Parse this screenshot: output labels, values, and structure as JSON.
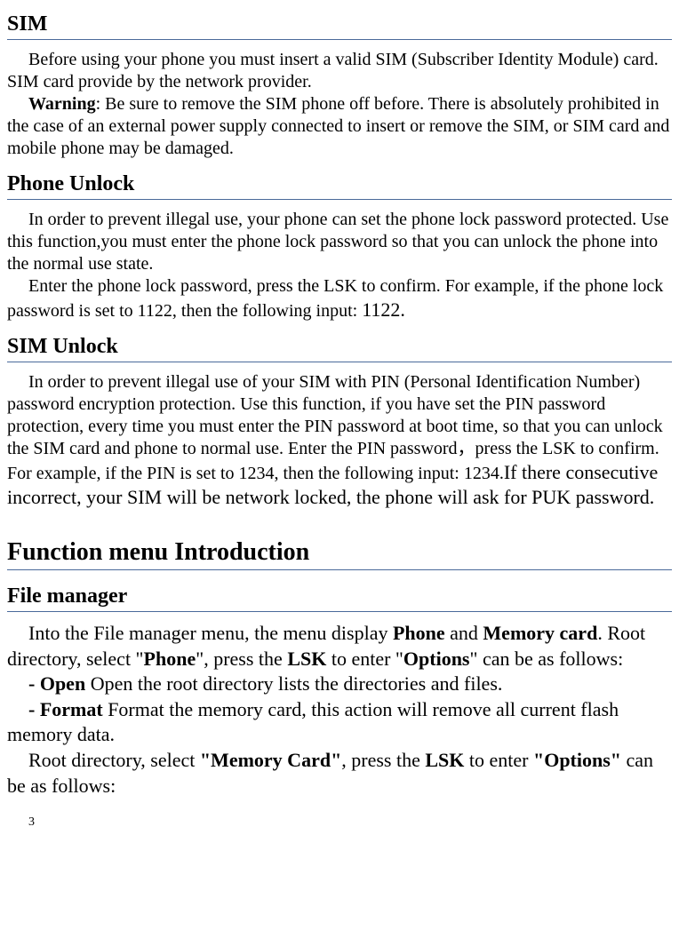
{
  "sim": {
    "heading": "SIM",
    "para1_before_warning": "Before using your phone you must insert a valid SIM (Subscriber Identity Module) card. SIM card provide by the network provider.",
    "warning_label": "Warning",
    "warning_text": ": Be sure to remove the SIM phone off before. There is absolutely prohibited in the case of an external power supply connected to insert or remove the SIM, or SIM card and mobile phone may be damaged."
  },
  "phone_unlock": {
    "heading": "Phone Unlock",
    "para1": "In order to prevent illegal use, your phone can set the phone lock password protected. Use this function,you must enter the phone lock password so that you can unlock the phone into the normal use state.",
    "para2_part1": "Enter the phone lock password, press the LSK to confirm. For example, if the phone lock password is set to 1122, then the following input: ",
    "para2_code": "1122."
  },
  "sim_unlock": {
    "heading": "SIM Unlock",
    "para1_part1": "In order to prevent illegal use of your SIM with PIN (Personal Identification Number) password encryption protection. Use this function, if you have set the PIN password protection, every time you must enter the PIN password at boot time, so that you can unlock the SIM card and phone to normal use. Enter the PIN password，press the LSK to confirm. For example, if the PIN is set to 1234, then the following input: 1234.",
    "para1_part2": "If there consecutive incorrect, your SIM will be network locked, the phone will ask for PUK password."
  },
  "function_menu": {
    "heading": "Function menu Introduction"
  },
  "file_manager": {
    "heading": "File manager",
    "intro_part1": "Into the File manager menu, the menu display ",
    "intro_phone": "Phone",
    "intro_part2": " and ",
    "intro_memory": "Memory card",
    "intro_part3": ". Root directory, select \"",
    "intro_phone2": "Phone",
    "intro_part4": "\", press the ",
    "intro_lsk": "LSK",
    "intro_part5": " to enter \"",
    "intro_options": "Options",
    "intro_part6": "\" can be as follows:",
    "open_label": "- Open",
    "open_desc": "        Open the root directory lists the directories and files.",
    "format_label": "- Format",
    "format_desc": "      Format the memory card, this action will remove all current flash memory data.",
    "root2_part1": "Root directory, select ",
    "root2_memory": "\"Memory Card\"",
    "root2_part2": ", press the ",
    "root2_lsk": "LSK",
    "root2_part3": " to enter ",
    "root2_options": "\"Options\"",
    "root2_part4": " can be as follows:"
  },
  "page_number": "3"
}
